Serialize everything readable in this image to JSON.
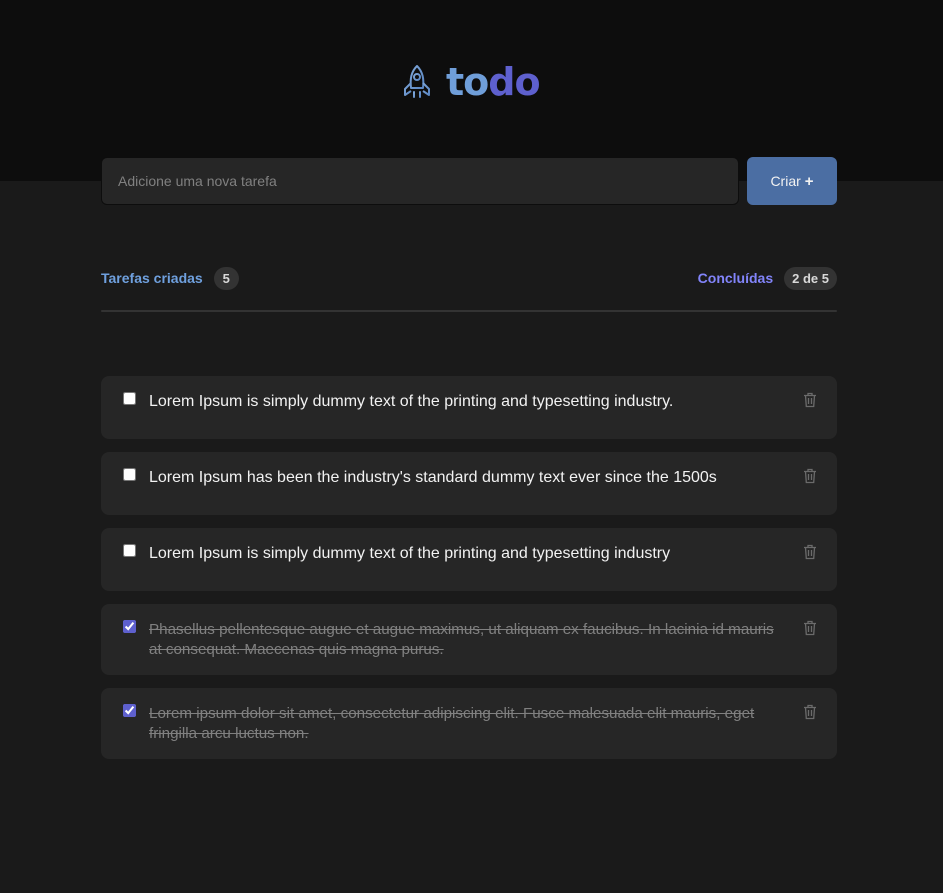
{
  "header": {
    "logo_part1": "to",
    "logo_part2": "do",
    "logo_icon": "rocket-icon"
  },
  "new_task": {
    "placeholder": "Adicione uma nova tarefa",
    "value": "",
    "button_label": "Criar",
    "button_icon": "+"
  },
  "stats": {
    "created_label": "Tarefas criadas",
    "created_count": "5",
    "done_label": "Concluídas",
    "done_count": "2 de 5"
  },
  "tasks": [
    {
      "text": "Lorem Ipsum is simply dummy text of the printing and typesetting industry.",
      "completed": false
    },
    {
      "text": "Lorem Ipsum has been the industry's standard dummy text ever since the 1500s",
      "completed": false
    },
    {
      "text": "Lorem Ipsum is simply dummy text of the printing and typesetting industry",
      "completed": false
    },
    {
      "text": "Phasellus pellentesque augue et augue maximus, ut aliquam ex faucibus. In lacinia id mauris at consequat. Maecenas quis magna purus.",
      "completed": true
    },
    {
      "text": "Lorem ipsum dolor sit amet, consectetur adipiscing elit. Fusce malesuada elit mauris, eget fringilla arcu luctus non.",
      "completed": true
    }
  ],
  "colors": {
    "header_bg": "#0d0d0d",
    "page_bg": "#1a1a1a",
    "card_bg": "#262626",
    "blue": "#4ea8de",
    "purple": "#8284fa",
    "button": "#4b6ea3"
  }
}
